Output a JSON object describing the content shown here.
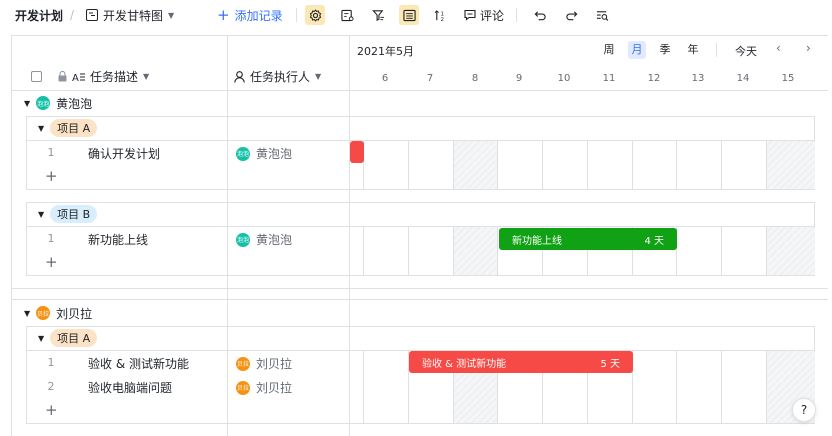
{
  "toolbar": {
    "breadcrumb_title": "开发计划",
    "separator": "/",
    "view_icon": "gantt-view-icon",
    "view_name": "开发甘特图",
    "add_record": "添加记录",
    "comment": "评论",
    "icons": [
      "settings-icon",
      "field-config-icon",
      "filter-icon",
      "group-icon",
      "sort-icon",
      "comment-icon",
      "undo-icon",
      "redo-icon",
      "search-icon"
    ]
  },
  "grid_header": {
    "col_task": "任务描述",
    "col_assignee": "任务执行人",
    "month": "2021年5月",
    "scales": [
      "周",
      "月",
      "季",
      "年"
    ],
    "selected_scale": "月",
    "today": "今天",
    "prev": "‹",
    "next": "›",
    "days": [
      "6",
      "7",
      "8",
      "9",
      "10",
      "11",
      "12",
      "13",
      "14",
      "15"
    ]
  },
  "groups": [
    {
      "owner": "黄泡泡",
      "avatar_text": "泡泡",
      "avatar_color": "#14c0a8",
      "subgroups": [
        {
          "tag": "项目 A",
          "rows": [
            {
              "num": "1",
              "title": "确认开发计划",
              "assignee": "黄泡泡",
              "avatar_text": "泡泡"
            }
          ]
        },
        {
          "tag": "项目 B",
          "rows": [
            {
              "num": "1",
              "title": "新功能上线",
              "assignee": "黄泡泡",
              "avatar_text": "泡泡"
            }
          ]
        }
      ]
    },
    {
      "owner": "刘贝拉",
      "avatar_text": "贝拉",
      "avatar_color": "#f79114",
      "subgroups": [
        {
          "tag": "项目 A",
          "rows": [
            {
              "num": "1",
              "title": "验收 & 测试新功能",
              "assignee": "刘贝拉",
              "avatar_text": "贝拉"
            },
            {
              "num": "2",
              "title": "验收电脑端问题",
              "assignee": "刘贝拉",
              "avatar_text": "贝拉"
            }
          ]
        }
      ]
    }
  ],
  "bars": [
    {
      "label": "",
      "duration": ""
    },
    {
      "label": "新功能上线",
      "duration": "4 天"
    },
    {
      "label": "验收 & 测试新功能",
      "duration": "5 天"
    }
  ],
  "colors": {
    "accent": "#3370ff",
    "bar_red": "#f54a45",
    "bar_green": "#10a214",
    "tag_a": "#fde3c6",
    "tag_b": "#d9eefc"
  },
  "add_row": "+",
  "help": "?"
}
